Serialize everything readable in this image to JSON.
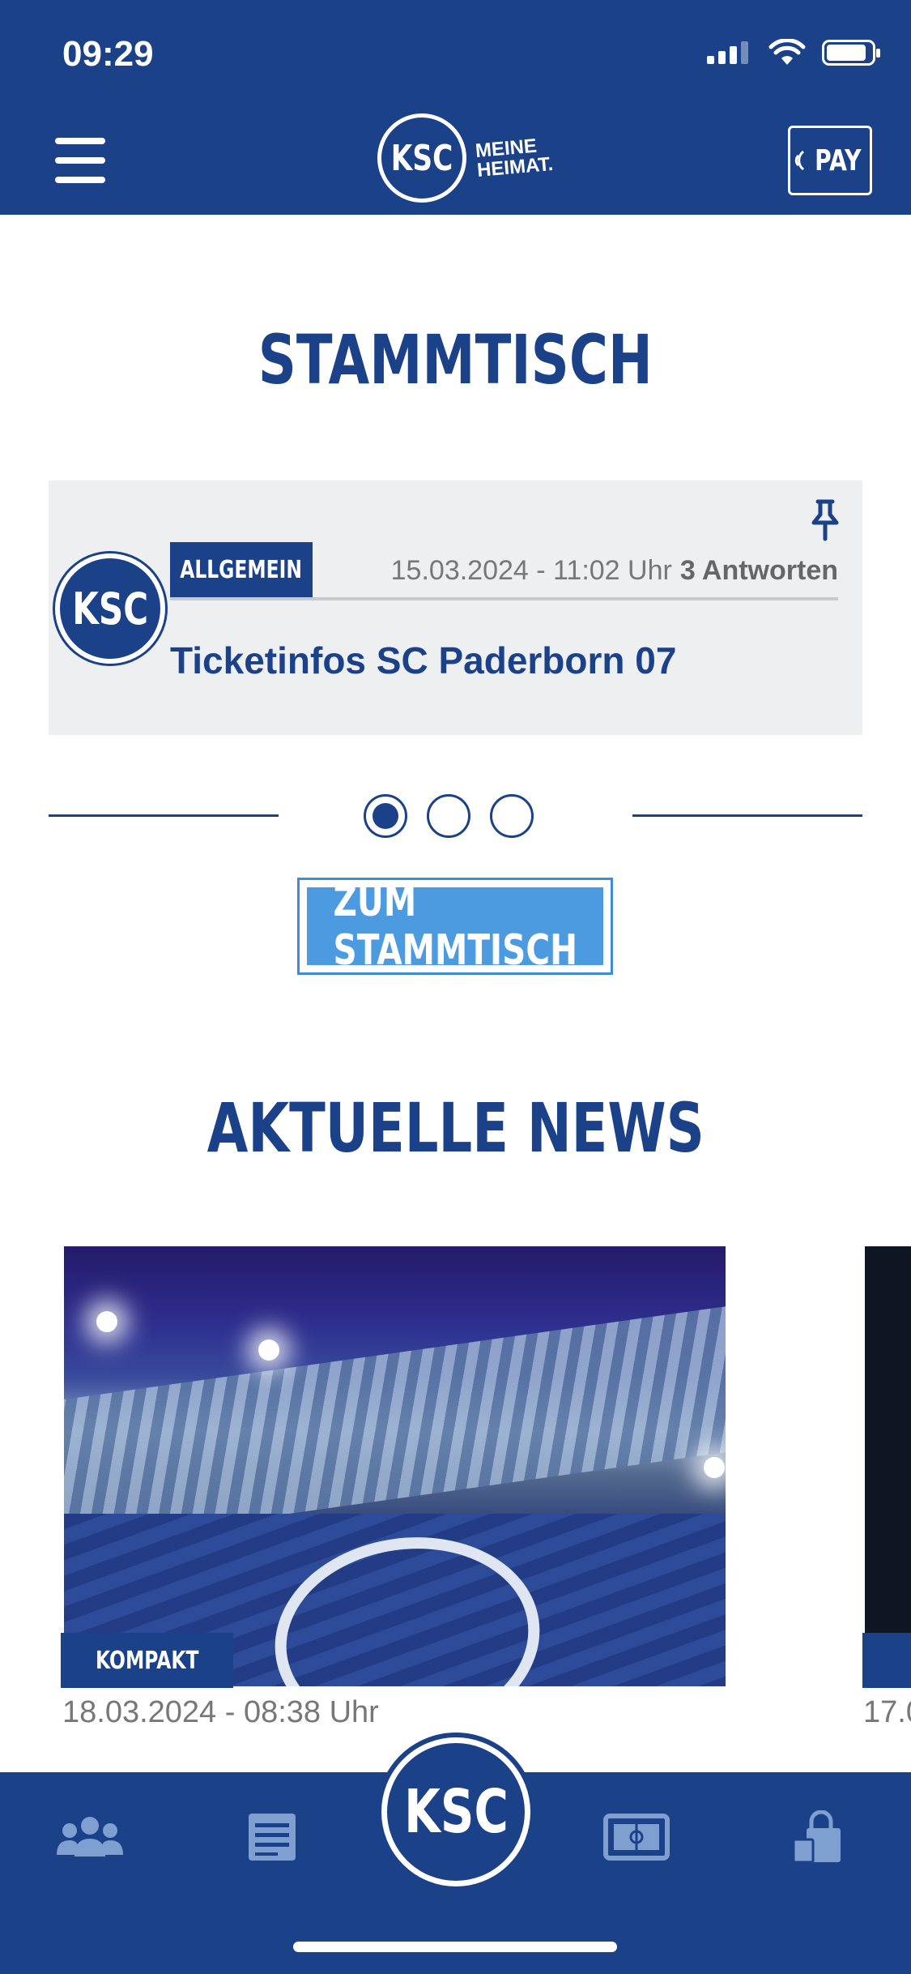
{
  "status_bar": {
    "time": "09:29"
  },
  "header": {
    "logo_text": "KSC",
    "logo_tagline_1": "MEINE",
    "logo_tagline_2": "HEIMAT.",
    "pay_label": "PAY"
  },
  "stammtisch": {
    "title": "STAMMTISCH",
    "post": {
      "avatar_text": "KSC",
      "category": "ALLGEMEIN",
      "date": "15.03.2024 - 11:02 Uhr",
      "replies": "3 Antworten",
      "title": "Ticketinfos SC Paderborn 07",
      "pinned_icon": "pin-icon"
    },
    "pager": {
      "count": 3,
      "active": 1
    },
    "button_label": "ZUM STAMMTISCH"
  },
  "news": {
    "title": "AKTUELLE NEWS",
    "items": [
      {
        "category": "KOMPAKT",
        "date": "18.03.2024 - 08:38 Uhr"
      },
      {
        "category": "",
        "date": "17.0"
      }
    ]
  },
  "tabbar": {
    "center_label": "KSC",
    "icons": [
      "community-icon",
      "news-icon",
      "home-logo",
      "stadium-icon",
      "shop-icon"
    ]
  },
  "colors": {
    "primary": "#1b4189",
    "accent": "#4c9be0",
    "card_bg": "#eeeff1"
  }
}
